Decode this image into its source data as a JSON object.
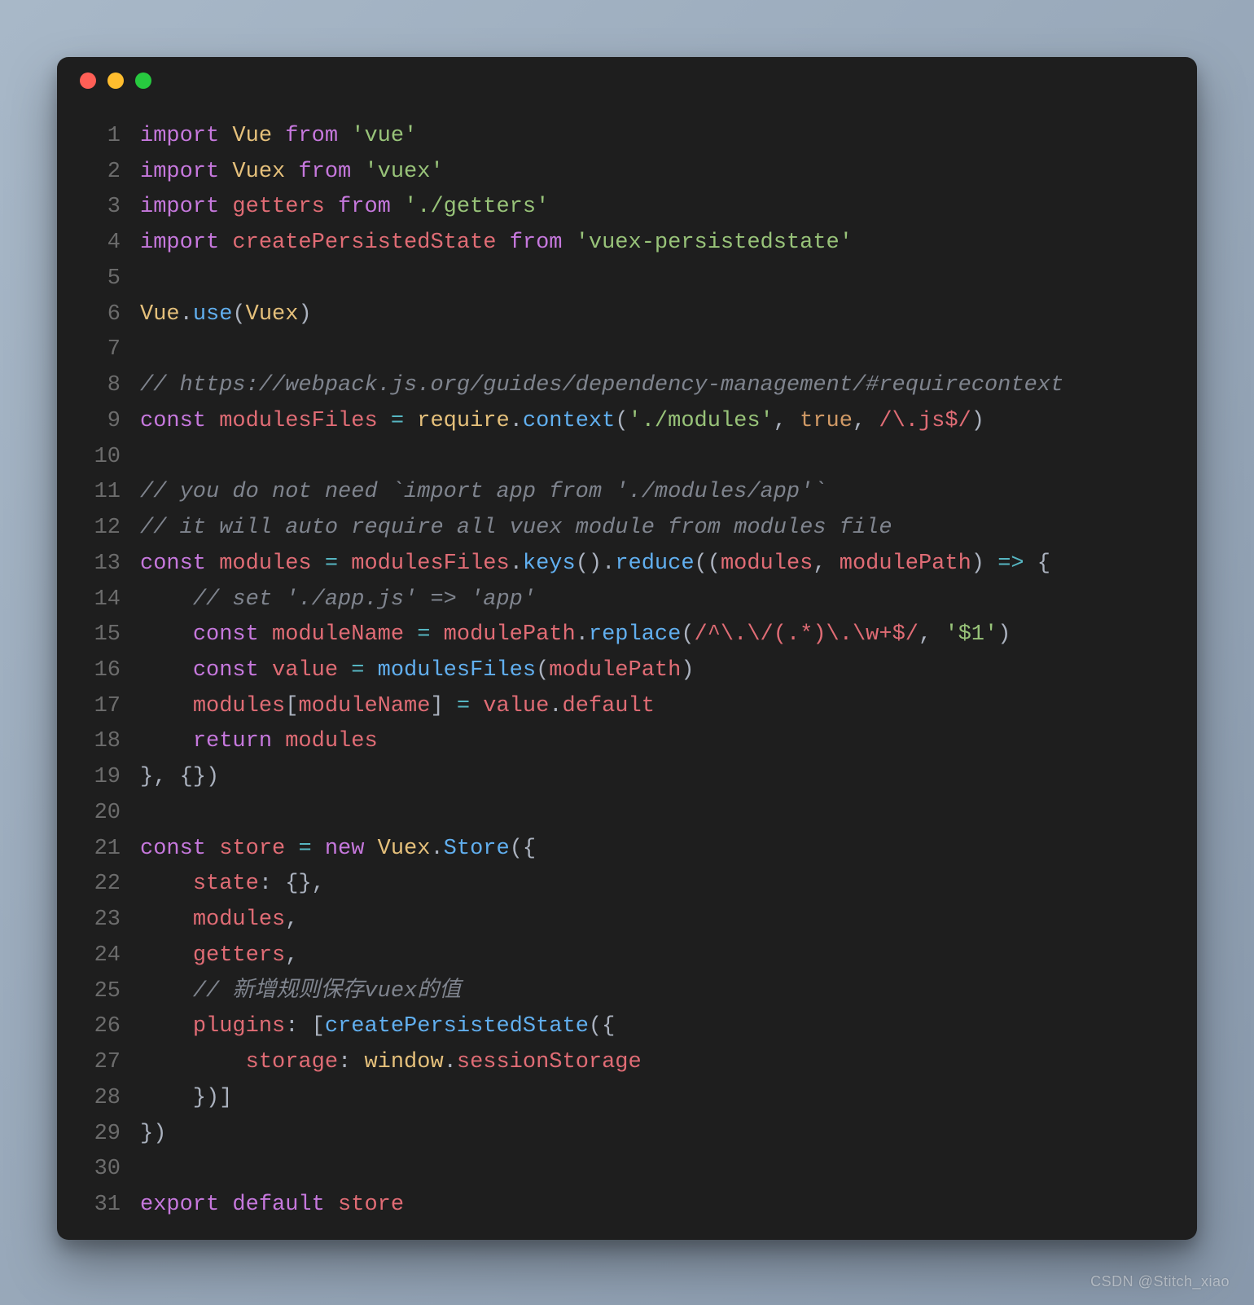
{
  "watermark": "CSDN @Stitch_xiao",
  "window": {
    "dots": [
      "red",
      "yellow",
      "green"
    ]
  },
  "code": {
    "lines": [
      {
        "n": 1,
        "tokens": [
          {
            "c": "tok-kw",
            "t": "import"
          },
          {
            "c": "tok-p",
            "t": " "
          },
          {
            "c": "tok-cls",
            "t": "Vue"
          },
          {
            "c": "tok-p",
            "t": " "
          },
          {
            "c": "tok-kw",
            "t": "from"
          },
          {
            "c": "tok-p",
            "t": " "
          },
          {
            "c": "tok-str",
            "t": "'vue'"
          }
        ]
      },
      {
        "n": 2,
        "tokens": [
          {
            "c": "tok-kw",
            "t": "import"
          },
          {
            "c": "tok-p",
            "t": " "
          },
          {
            "c": "tok-cls",
            "t": "Vuex"
          },
          {
            "c": "tok-p",
            "t": " "
          },
          {
            "c": "tok-kw",
            "t": "from"
          },
          {
            "c": "tok-p",
            "t": " "
          },
          {
            "c": "tok-str",
            "t": "'vuex'"
          }
        ]
      },
      {
        "n": 3,
        "tokens": [
          {
            "c": "tok-kw",
            "t": "import"
          },
          {
            "c": "tok-p",
            "t": " "
          },
          {
            "c": "tok-id",
            "t": "getters"
          },
          {
            "c": "tok-p",
            "t": " "
          },
          {
            "c": "tok-kw",
            "t": "from"
          },
          {
            "c": "tok-p",
            "t": " "
          },
          {
            "c": "tok-str",
            "t": "'./getters'"
          }
        ]
      },
      {
        "n": 4,
        "tokens": [
          {
            "c": "tok-kw",
            "t": "import"
          },
          {
            "c": "tok-p",
            "t": " "
          },
          {
            "c": "tok-id",
            "t": "createPersistedState"
          },
          {
            "c": "tok-p",
            "t": " "
          },
          {
            "c": "tok-kw",
            "t": "from"
          },
          {
            "c": "tok-p",
            "t": " "
          },
          {
            "c": "tok-str",
            "t": "'vuex-persistedstate'"
          }
        ]
      },
      {
        "n": 5,
        "tokens": []
      },
      {
        "n": 6,
        "tokens": [
          {
            "c": "tok-cls",
            "t": "Vue"
          },
          {
            "c": "tok-p",
            "t": "."
          },
          {
            "c": "tok-fn",
            "t": "use"
          },
          {
            "c": "tok-p",
            "t": "("
          },
          {
            "c": "tok-cls",
            "t": "Vuex"
          },
          {
            "c": "tok-p",
            "t": ")"
          }
        ]
      },
      {
        "n": 7,
        "tokens": []
      },
      {
        "n": 8,
        "tokens": [
          {
            "c": "tok-cmt",
            "t": "// https://webpack.js.org/guides/dependency-management/#requirecontext"
          }
        ]
      },
      {
        "n": 9,
        "tokens": [
          {
            "c": "tok-kw",
            "t": "const"
          },
          {
            "c": "tok-p",
            "t": " "
          },
          {
            "c": "tok-id",
            "t": "modulesFiles"
          },
          {
            "c": "tok-p",
            "t": " "
          },
          {
            "c": "tok-op",
            "t": "="
          },
          {
            "c": "tok-p",
            "t": " "
          },
          {
            "c": "tok-cls",
            "t": "require"
          },
          {
            "c": "tok-p",
            "t": "."
          },
          {
            "c": "tok-fn",
            "t": "context"
          },
          {
            "c": "tok-p",
            "t": "("
          },
          {
            "c": "tok-str",
            "t": "'./modules'"
          },
          {
            "c": "tok-p",
            "t": ", "
          },
          {
            "c": "tok-num",
            "t": "true"
          },
          {
            "c": "tok-p",
            "t": ", "
          },
          {
            "c": "tok-re",
            "t": "/\\.js$/"
          },
          {
            "c": "tok-p",
            "t": ")"
          }
        ]
      },
      {
        "n": 10,
        "tokens": []
      },
      {
        "n": 11,
        "tokens": [
          {
            "c": "tok-cmt",
            "t": "// you do not need `import app from './modules/app'`"
          }
        ]
      },
      {
        "n": 12,
        "tokens": [
          {
            "c": "tok-cmt",
            "t": "// it will auto require all vuex module from modules file"
          }
        ]
      },
      {
        "n": 13,
        "tokens": [
          {
            "c": "tok-kw",
            "t": "const"
          },
          {
            "c": "tok-p",
            "t": " "
          },
          {
            "c": "tok-id",
            "t": "modules"
          },
          {
            "c": "tok-p",
            "t": " "
          },
          {
            "c": "tok-op",
            "t": "="
          },
          {
            "c": "tok-p",
            "t": " "
          },
          {
            "c": "tok-id",
            "t": "modulesFiles"
          },
          {
            "c": "tok-p",
            "t": "."
          },
          {
            "c": "tok-fn",
            "t": "keys"
          },
          {
            "c": "tok-p",
            "t": "()."
          },
          {
            "c": "tok-fn",
            "t": "reduce"
          },
          {
            "c": "tok-p",
            "t": "(("
          },
          {
            "c": "tok-id",
            "t": "modules"
          },
          {
            "c": "tok-p",
            "t": ", "
          },
          {
            "c": "tok-id",
            "t": "modulePath"
          },
          {
            "c": "tok-p",
            "t": ") "
          },
          {
            "c": "tok-op",
            "t": "=>"
          },
          {
            "c": "tok-p",
            "t": " {"
          }
        ]
      },
      {
        "n": 14,
        "tokens": [
          {
            "c": "tok-p",
            "t": "    "
          },
          {
            "c": "tok-cmt",
            "t": "// set './app.js' => 'app'"
          }
        ]
      },
      {
        "n": 15,
        "tokens": [
          {
            "c": "tok-p",
            "t": "    "
          },
          {
            "c": "tok-kw",
            "t": "const"
          },
          {
            "c": "tok-p",
            "t": " "
          },
          {
            "c": "tok-id",
            "t": "moduleName"
          },
          {
            "c": "tok-p",
            "t": " "
          },
          {
            "c": "tok-op",
            "t": "="
          },
          {
            "c": "tok-p",
            "t": " "
          },
          {
            "c": "tok-id",
            "t": "modulePath"
          },
          {
            "c": "tok-p",
            "t": "."
          },
          {
            "c": "tok-fn",
            "t": "replace"
          },
          {
            "c": "tok-p",
            "t": "("
          },
          {
            "c": "tok-re",
            "t": "/^\\.\\/(.*)\\.\\w+$/"
          },
          {
            "c": "tok-p",
            "t": ", "
          },
          {
            "c": "tok-str",
            "t": "'$1'"
          },
          {
            "c": "tok-p",
            "t": ")"
          }
        ]
      },
      {
        "n": 16,
        "tokens": [
          {
            "c": "tok-p",
            "t": "    "
          },
          {
            "c": "tok-kw",
            "t": "const"
          },
          {
            "c": "tok-p",
            "t": " "
          },
          {
            "c": "tok-id",
            "t": "value"
          },
          {
            "c": "tok-p",
            "t": " "
          },
          {
            "c": "tok-op",
            "t": "="
          },
          {
            "c": "tok-p",
            "t": " "
          },
          {
            "c": "tok-fn",
            "t": "modulesFiles"
          },
          {
            "c": "tok-p",
            "t": "("
          },
          {
            "c": "tok-id",
            "t": "modulePath"
          },
          {
            "c": "tok-p",
            "t": ")"
          }
        ]
      },
      {
        "n": 17,
        "tokens": [
          {
            "c": "tok-p",
            "t": "    "
          },
          {
            "c": "tok-id",
            "t": "modules"
          },
          {
            "c": "tok-p",
            "t": "["
          },
          {
            "c": "tok-id",
            "t": "moduleName"
          },
          {
            "c": "tok-p",
            "t": "] "
          },
          {
            "c": "tok-op",
            "t": "="
          },
          {
            "c": "tok-p",
            "t": " "
          },
          {
            "c": "tok-id",
            "t": "value"
          },
          {
            "c": "tok-p",
            "t": "."
          },
          {
            "c": "tok-id",
            "t": "default"
          }
        ]
      },
      {
        "n": 18,
        "tokens": [
          {
            "c": "tok-p",
            "t": "    "
          },
          {
            "c": "tok-kw",
            "t": "return"
          },
          {
            "c": "tok-p",
            "t": " "
          },
          {
            "c": "tok-id",
            "t": "modules"
          }
        ]
      },
      {
        "n": 19,
        "tokens": [
          {
            "c": "tok-p",
            "t": "}, {})"
          }
        ]
      },
      {
        "n": 20,
        "tokens": []
      },
      {
        "n": 21,
        "tokens": [
          {
            "c": "tok-kw",
            "t": "const"
          },
          {
            "c": "tok-p",
            "t": " "
          },
          {
            "c": "tok-id",
            "t": "store"
          },
          {
            "c": "tok-p",
            "t": " "
          },
          {
            "c": "tok-op",
            "t": "="
          },
          {
            "c": "tok-p",
            "t": " "
          },
          {
            "c": "tok-kw",
            "t": "new"
          },
          {
            "c": "tok-p",
            "t": " "
          },
          {
            "c": "tok-cls",
            "t": "Vuex"
          },
          {
            "c": "tok-p",
            "t": "."
          },
          {
            "c": "tok-fn",
            "t": "Store"
          },
          {
            "c": "tok-p",
            "t": "({"
          }
        ]
      },
      {
        "n": 22,
        "tokens": [
          {
            "c": "tok-p",
            "t": "    "
          },
          {
            "c": "tok-id",
            "t": "state"
          },
          {
            "c": "tok-p",
            "t": ": {},"
          }
        ]
      },
      {
        "n": 23,
        "tokens": [
          {
            "c": "tok-p",
            "t": "    "
          },
          {
            "c": "tok-id",
            "t": "modules"
          },
          {
            "c": "tok-p",
            "t": ","
          }
        ]
      },
      {
        "n": 24,
        "tokens": [
          {
            "c": "tok-p",
            "t": "    "
          },
          {
            "c": "tok-id",
            "t": "getters"
          },
          {
            "c": "tok-p",
            "t": ","
          }
        ]
      },
      {
        "n": 25,
        "tokens": [
          {
            "c": "tok-p",
            "t": "    "
          },
          {
            "c": "tok-cmt",
            "t": "// 新增规则保存vuex的值"
          }
        ]
      },
      {
        "n": 26,
        "tokens": [
          {
            "c": "tok-p",
            "t": "    "
          },
          {
            "c": "tok-id",
            "t": "plugins"
          },
          {
            "c": "tok-p",
            "t": ": ["
          },
          {
            "c": "tok-fn",
            "t": "createPersistedState"
          },
          {
            "c": "tok-p",
            "t": "({"
          }
        ]
      },
      {
        "n": 27,
        "tokens": [
          {
            "c": "tok-p",
            "t": "        "
          },
          {
            "c": "tok-id",
            "t": "storage"
          },
          {
            "c": "tok-p",
            "t": ": "
          },
          {
            "c": "tok-cls",
            "t": "window"
          },
          {
            "c": "tok-p",
            "t": "."
          },
          {
            "c": "tok-id",
            "t": "sessionStorage"
          }
        ]
      },
      {
        "n": 28,
        "tokens": [
          {
            "c": "tok-p",
            "t": "    })]"
          }
        ]
      },
      {
        "n": 29,
        "tokens": [
          {
            "c": "tok-p",
            "t": "})"
          }
        ]
      },
      {
        "n": 30,
        "tokens": []
      },
      {
        "n": 31,
        "tokens": [
          {
            "c": "tok-kw",
            "t": "export"
          },
          {
            "c": "tok-p",
            "t": " "
          },
          {
            "c": "tok-kw",
            "t": "default"
          },
          {
            "c": "tok-p",
            "t": " "
          },
          {
            "c": "tok-id",
            "t": "store"
          }
        ]
      }
    ]
  }
}
